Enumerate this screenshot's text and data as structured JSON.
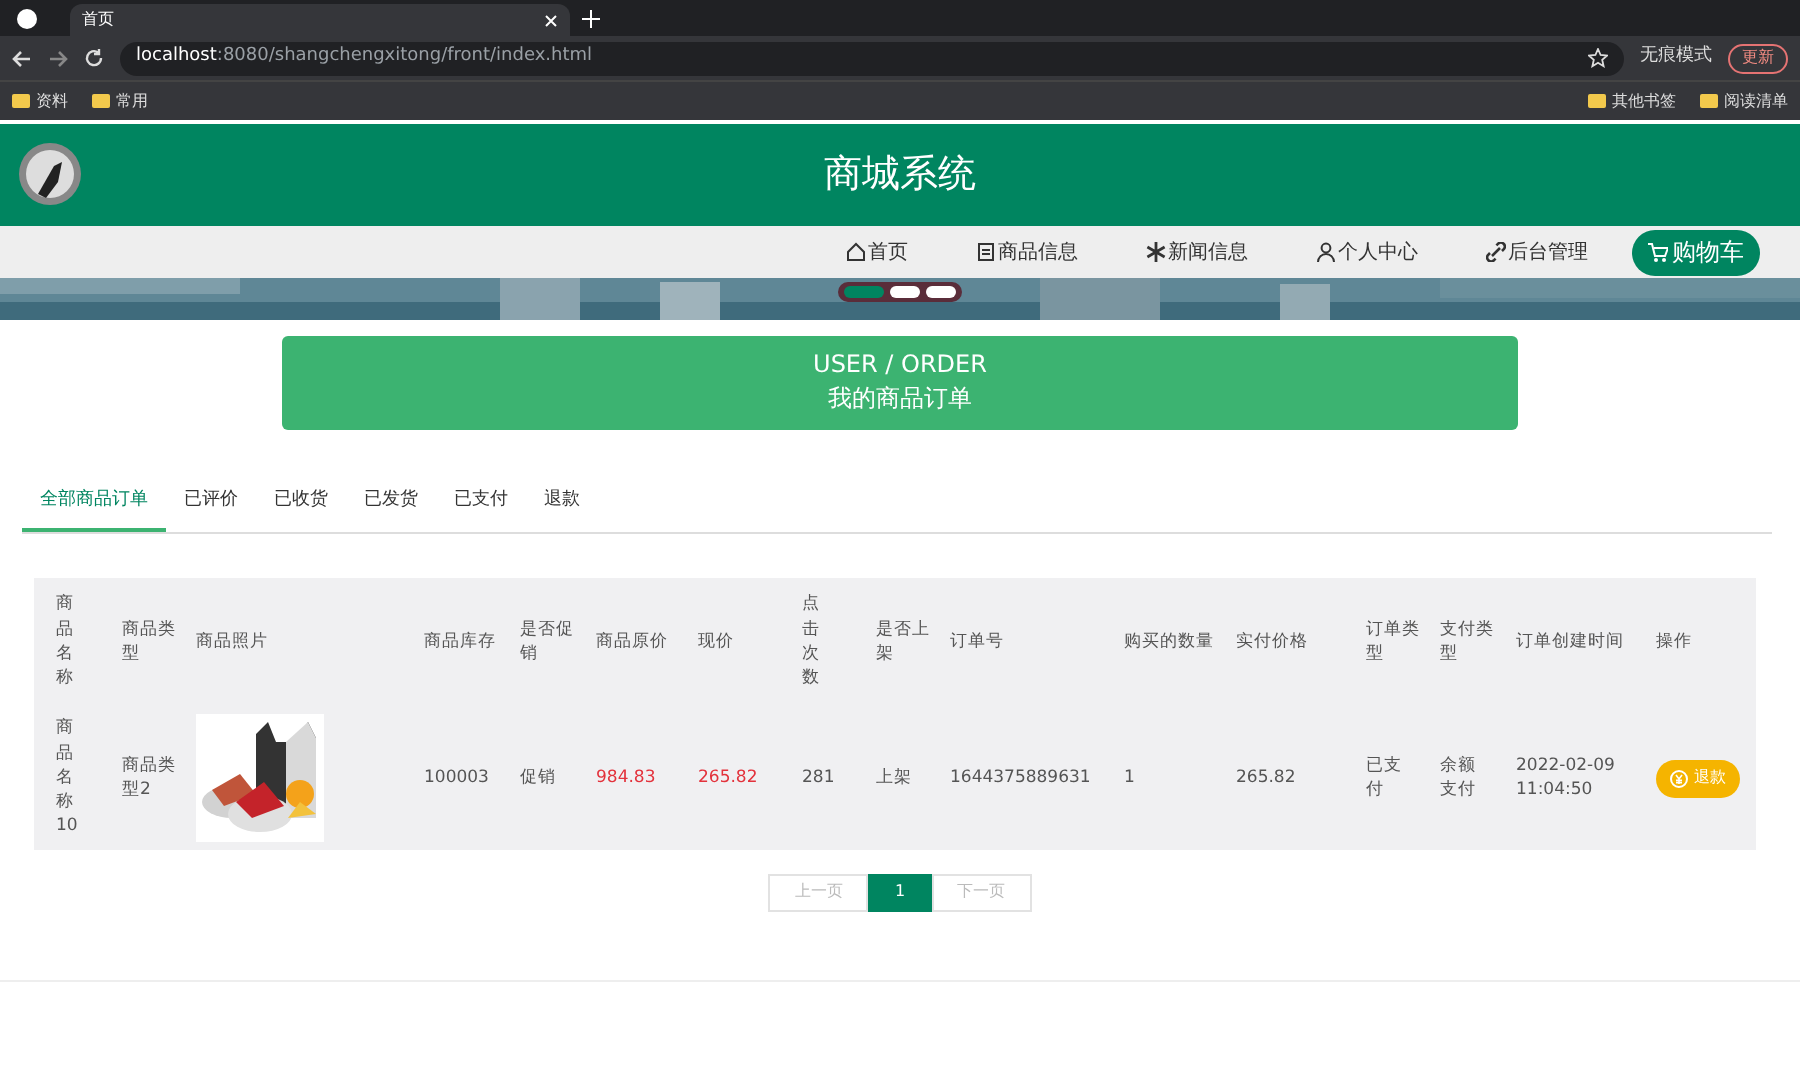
{
  "browser": {
    "tabs": [
      {
        "title": "首页",
        "selected": true
      }
    ],
    "url_host": "localhost",
    "url_rest": ":8080/shangchengxitong/front/index.html",
    "profile": "无痕模式",
    "update_button": "更新",
    "bookmarks_left": [
      "资料",
      "常用"
    ],
    "bookmarks_right": [
      "其他书签",
      "阅读清单"
    ]
  },
  "header": {
    "title": "商城系统"
  },
  "nav": [
    {
      "label": "首页"
    },
    {
      "label": "商品信息"
    },
    {
      "label": "新闻信息"
    },
    {
      "label": "个人中心"
    },
    {
      "label": "后台管理"
    }
  ],
  "cart_button": "购物车",
  "carousel": {
    "dots": [
      {
        "selected": true
      },
      {
        "selected": false
      },
      {
        "selected": false
      }
    ]
  },
  "section_banner": {
    "line1": "USER / ORDER",
    "line2": "我的商品订单"
  },
  "order_tabs": [
    {
      "label": "全部商品订单",
      "selected": true
    },
    {
      "label": "已评价",
      "selected": false
    },
    {
      "label": "已收货",
      "selected": false
    },
    {
      "label": "已发货",
      "selected": false
    },
    {
      "label": "已支付",
      "selected": false
    },
    {
      "label": "退款",
      "selected": false
    }
  ],
  "table": {
    "columns": [
      "商品名称",
      "商品类型",
      "商品照片",
      "商品库存",
      "是否促销",
      "商品原价",
      "现价",
      "点击次数",
      "是否上架",
      "订单号",
      "购买的数量",
      "实付价格",
      "订单类型",
      "支付类型",
      "订单创建时间",
      "操作"
    ],
    "rows": [
      {
        "cells": [
          "商品名称10",
          "商品类型2",
          {
            "kind": "picture"
          },
          "100003",
          "促销",
          "984.83",
          "265.82",
          "281",
          "上架",
          "1644375889631",
          "1",
          "265.82",
          "已支付",
          "余额支付",
          "2022-02-09 11:04:50"
        ],
        "action": "退款"
      }
    ]
  },
  "pagination": {
    "prev": "上一页",
    "pages": [
      {
        "label": "1",
        "selected": true
      }
    ],
    "next": "下一页"
  }
}
